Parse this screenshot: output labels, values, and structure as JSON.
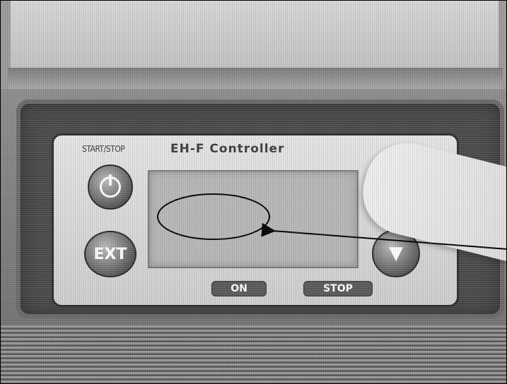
{
  "controller": {
    "start_stop_label": "START/STOP",
    "title": "EH-F Controller",
    "exit_label": "EXT",
    "down_symbol": "▼",
    "power_icon": "power-icon"
  },
  "status_labels": {
    "on": "ON",
    "stop": "STOP"
  },
  "annotation": {
    "ellipse_color": "#000000",
    "arrow_color": "#000000"
  }
}
